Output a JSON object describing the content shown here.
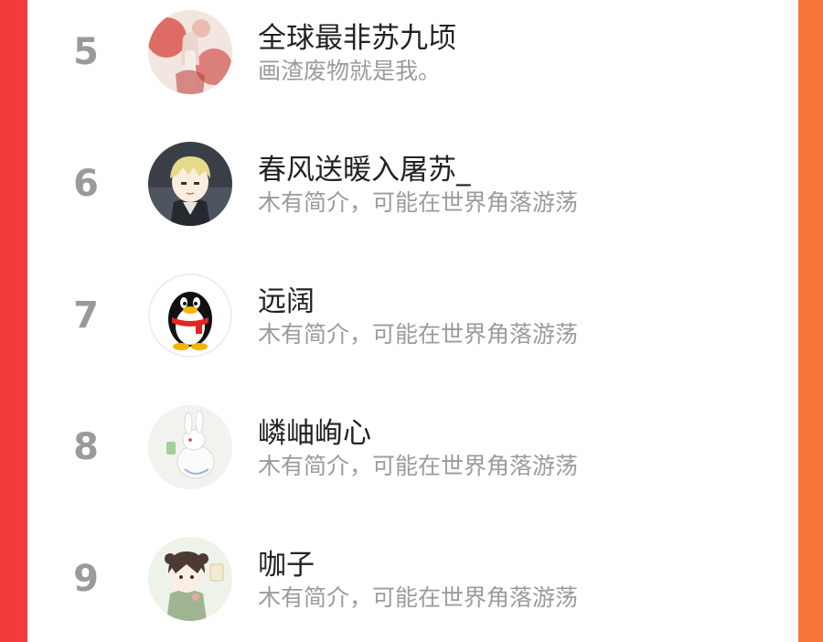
{
  "colors": {
    "background_left": "#f33a3c",
    "background_right": "#f7773a",
    "panel": "#ffffff",
    "rank_text": "#9a9a9a",
    "name_text": "#222222",
    "bio_text": "#9b9b9b"
  },
  "users": [
    {
      "rank": "5",
      "name": "全球最非苏九顷",
      "bio": "画渣废物就是我。",
      "avatar_icon": "red-ink-girl-avatar"
    },
    {
      "rank": "6",
      "name": "春风送暖入屠苏_",
      "bio": "木有简介，可能在世界角落游荡",
      "avatar_icon": "anime-boy-avatar"
    },
    {
      "rank": "7",
      "name": "远阔",
      "bio": "木有简介，可能在世界角落游荡",
      "avatar_icon": "qq-penguin-avatar"
    },
    {
      "rank": "8",
      "name": "嶙岫峋心",
      "bio": "木有简介，可能在世界角落游荡",
      "avatar_icon": "white-rabbit-avatar"
    },
    {
      "rank": "9",
      "name": "咖子",
      "bio": "木有简介，可能在世界角落游荡",
      "avatar_icon": "chibi-girl-avatar"
    }
  ]
}
